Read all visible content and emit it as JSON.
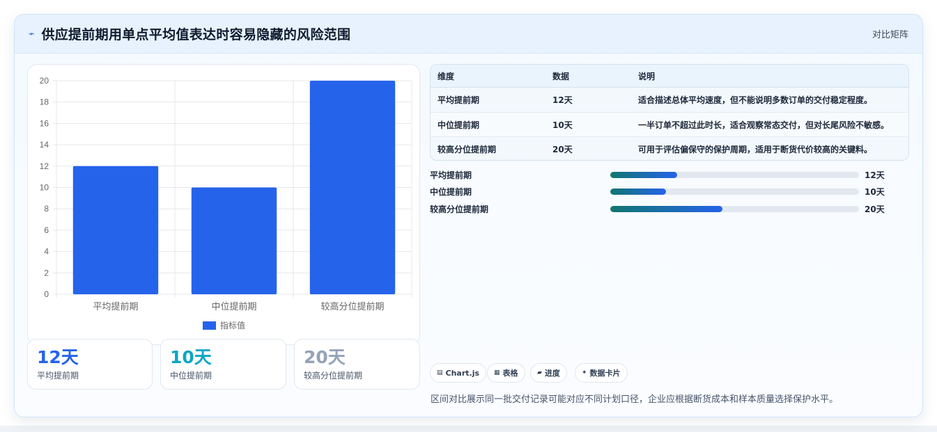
{
  "header": {
    "title": "供应提前期用单点平均值表达时容易隐藏的风险范围",
    "icon": "lightning-icon",
    "link": "对比矩阵"
  },
  "chart_data": {
    "type": "bar",
    "categories": [
      "平均提前期",
      "中位提前期",
      "较高分位提前期"
    ],
    "series": [
      {
        "name": "指标值",
        "values": [
          12,
          10,
          20
        ],
        "color": "#2563eb"
      }
    ],
    "ylim": [
      0,
      20
    ],
    "yticks": [
      0,
      2,
      4,
      6,
      8,
      10,
      12,
      14,
      16,
      18,
      20
    ],
    "grid": true,
    "legend_position": "bottom"
  },
  "stats": [
    {
      "value": "12天",
      "label": "平均提前期",
      "color": "#2563eb"
    },
    {
      "value": "10天",
      "label": "中位提前期",
      "color": "#0ea5c4"
    },
    {
      "value": "20天",
      "label": "较高分位提前期",
      "color": "#94a3b8"
    }
  ],
  "table": {
    "headers": [
      "维度",
      "数据",
      "说明"
    ],
    "rows": [
      [
        "平均提前期",
        "12天",
        "适合描述总体平均速度，但不能说明多数订单的交付稳定程度。"
      ],
      [
        "中位提前期",
        "10天",
        "一半订单不超过此时长，适合观察常态交付，但对长尾风险不敏感。"
      ],
      [
        "较高分位提前期",
        "20天",
        "可用于评估偏保守的保护周期，适用于断货代价较高的关键料。"
      ]
    ]
  },
  "progress": [
    {
      "label": "平均提前期",
      "value": "12天",
      "fraction": 0.27
    },
    {
      "label": "中位提前期",
      "value": "10天",
      "fraction": 0.225
    },
    {
      "label": "较高分位提前期",
      "value": "20天",
      "fraction": 0.45
    }
  ],
  "tags": [
    {
      "icon": "chart-icon",
      "glyph": "▤",
      "label": "Chart.js"
    },
    {
      "icon": "table-icon",
      "glyph": "▦",
      "label": "表格"
    },
    {
      "icon": "progress-icon",
      "glyph": "▰",
      "label": "进度"
    },
    {
      "icon": "sparkle-icon",
      "glyph": "✦",
      "label": "数据卡片"
    }
  ],
  "footnote": "区间对比展示同一批交付记录可能对应不同计划口径，企业应根据断货成本和样本质量选择保护水平。"
}
